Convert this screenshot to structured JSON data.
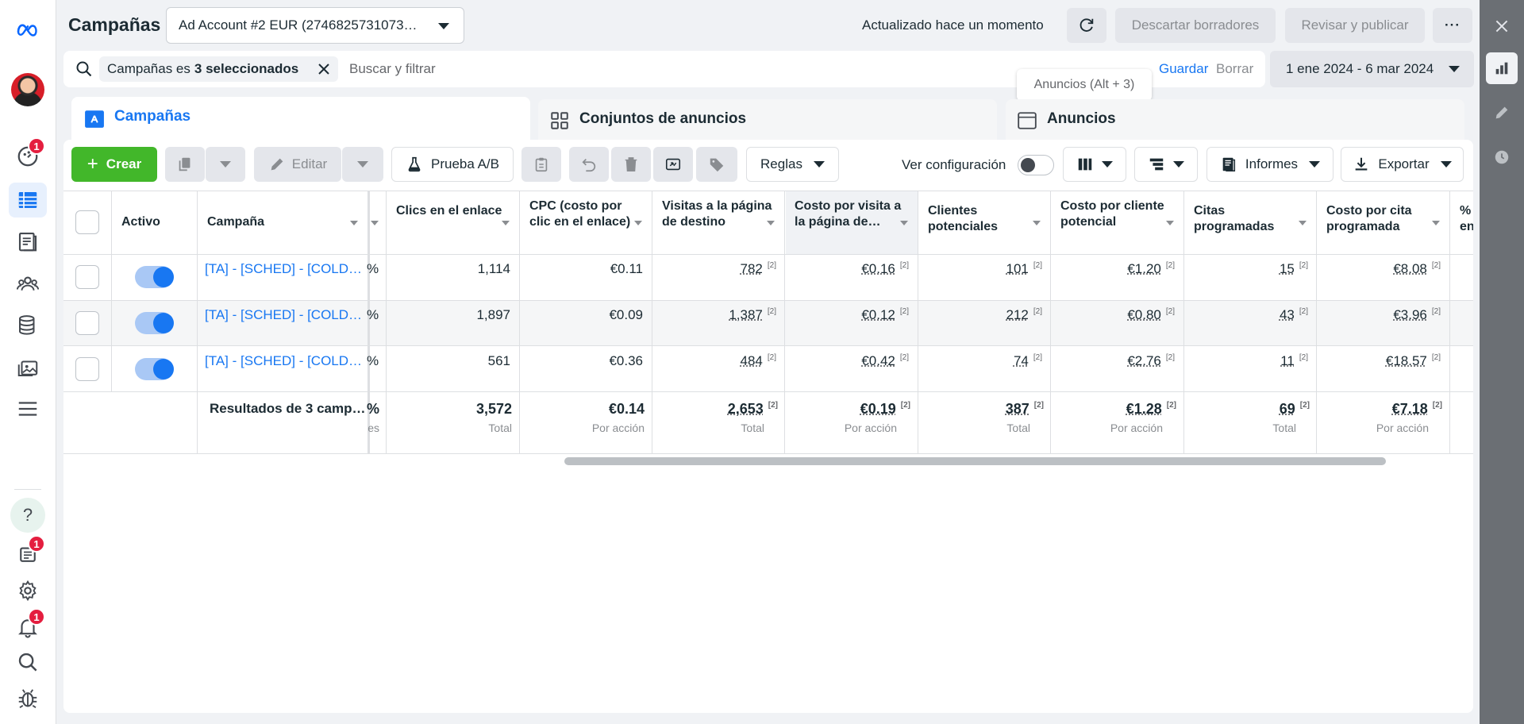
{
  "header": {
    "title": "Campañas",
    "account": "Ad Account #2 EUR (2746825731073…",
    "updated": "Actualizado hace un momento",
    "discard": "Descartar borradores",
    "publish": "Revisar y publicar",
    "more": "···"
  },
  "search": {
    "chip_prefix": "Campañas es",
    "chip_value": "3 seleccionados",
    "placeholder": "Buscar y filtrar",
    "save": "Guardar",
    "clear": "Borrar",
    "date_range": "1 ene 2024 - 6 mar 2024",
    "tooltip": "Anuncios (Alt + 3)"
  },
  "tabs": {
    "campaigns": "Campañas",
    "adsets": "Conjuntos de anuncios",
    "ads": "Anuncios"
  },
  "toolbar": {
    "create": "Crear",
    "edit": "Editar",
    "ab_test": "Prueba A/B",
    "rules": "Reglas",
    "view_config": "Ver configuración",
    "reports": "Informes",
    "export": "Exportar"
  },
  "nav": {
    "badges": {
      "ads_manager_home": "1",
      "pages": "1",
      "notifications": "1"
    }
  },
  "columns": {
    "activo": "Activo",
    "campana": "Campaña",
    "clics": "Clics en el enlace",
    "cpc": "CPC (costo por clic en el enlace)",
    "visitas": "Visitas a la página de destino",
    "costo_visita": "Costo por visita a la página de…",
    "clientes": "Clientes potenciales",
    "costo_cliente": "Costo por cliente potencial",
    "citas": "Citas programadas",
    "costo_cita": "Costo por cita programada",
    "pct_partial": "% en"
  },
  "rows": [
    {
      "name": "[TA] - [SCHED] - [COLD …",
      "pct": "%",
      "clics": "1,114",
      "cpc": "€0.11",
      "visitas": "782",
      "costo_visita": "€0.16",
      "clientes": "101",
      "costo_cliente": "€1.20",
      "citas": "15",
      "costo_cita": "€8.08",
      "fn": "[2]"
    },
    {
      "name": "[TA] - [SCHED] - [COLD …",
      "pct": "%",
      "clics": "1,897",
      "cpc": "€0.09",
      "visitas": "1,387",
      "costo_visita": "€0.12",
      "clientes": "212",
      "costo_cliente": "€0.80",
      "citas": "43",
      "costo_cita": "€3.96",
      "fn": "[2]"
    },
    {
      "name": "[TA] - [SCHED] - [COLD …",
      "pct": "%",
      "clics": "561",
      "cpc": "€0.36",
      "visitas": "484",
      "costo_visita": "€0.42",
      "clientes": "74",
      "costo_cliente": "€2.76",
      "citas": "11",
      "costo_cita": "€18.57",
      "fn": "[2]"
    }
  ],
  "totals": {
    "label": "Resultados de 3 camp…",
    "pct": "%",
    "pct_sub": "es",
    "clics": "3,572",
    "clics_sub": "Total",
    "cpc": "€0.14",
    "cpc_sub": "Por acción",
    "visitas": "2,653",
    "visitas_sub": "Total",
    "costo_visita": "€0.19",
    "costo_visita_sub": "Por acción",
    "clientes": "387",
    "clientes_sub": "Total",
    "costo_cliente": "€1.28",
    "costo_cliente_sub": "Por acción",
    "citas": "69",
    "citas_sub": "Total",
    "costo_cita": "€7.18",
    "costo_cita_sub": "Por acción",
    "fn": "[2]"
  },
  "colors": {
    "accent": "#1877f2",
    "create": "#42b72a",
    "badge": "#e41e3f"
  }
}
